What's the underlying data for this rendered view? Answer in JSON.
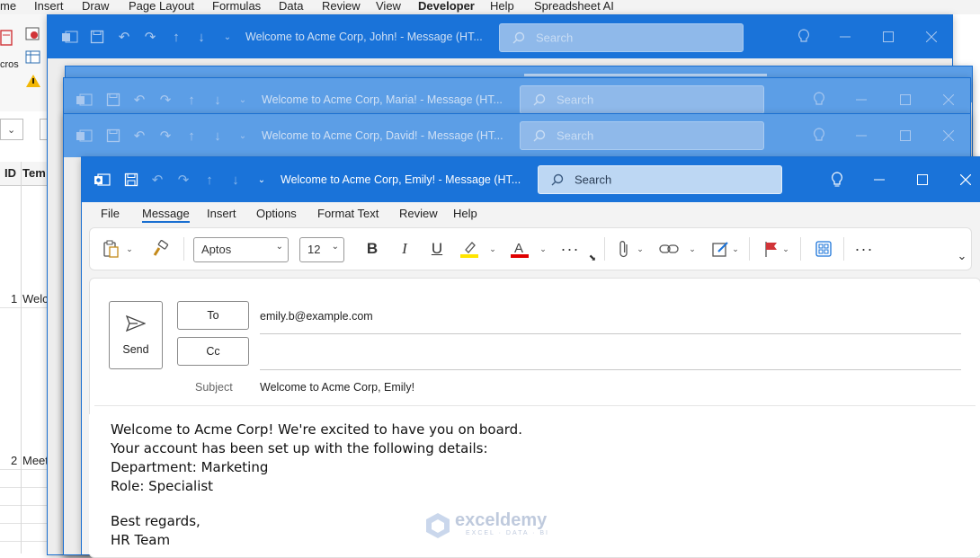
{
  "excel": {
    "menu": [
      "me",
      "Insert",
      "Draw",
      "Page Layout",
      "Formulas",
      "Data",
      "Review",
      "View",
      "Developer",
      "Help",
      "Spreadsheet AI"
    ],
    "ribbon_label": "cros",
    "col_id": "ID",
    "col_tem": "Tem",
    "row1_num": "1",
    "row1_text": "Welc",
    "row2_num": "2",
    "row2_text": "Meet"
  },
  "windows": {
    "john": {
      "title": "Welcome to Acme Corp, John!  -  Message (HT...",
      "search": "Search"
    },
    "maria": {
      "title": "Welcome to Acme Corp, Maria!  -  Message (HT...",
      "search": "Search"
    },
    "david": {
      "title": "Welcome to Acme Corp, David!  -  Message (HT...",
      "search": "Search"
    }
  },
  "main": {
    "title": "Welcome to Acme Corp, Emily!  -  Message (HT...",
    "search": "Search",
    "menu_tabs": [
      "File",
      "Message",
      "Insert",
      "Options",
      "Format Text",
      "Review",
      "Help"
    ],
    "active_tab": "Message",
    "font_name": "Aptos",
    "font_size": "12",
    "send_label": "Send",
    "to_label": "To",
    "cc_label": "Cc",
    "subject_label": "Subject",
    "to_value": "emily.b@example.com",
    "cc_value": "",
    "subject_value": "Welcome to Acme Corp, Emily!",
    "body": [
      "Welcome to Acme Corp! We're excited to have you on board.",
      "Your account has been set up with the following details:",
      "Department: Marketing",
      "Role: Specialist",
      "",
      "Best regards,",
      "HR Team"
    ],
    "highlight_color": "#ffe500",
    "font_color": "#e00000",
    "accent": "#1a73d9"
  },
  "watermark": {
    "name": "exceldemy",
    "tagline": "EXCEL · DATA · BI"
  }
}
